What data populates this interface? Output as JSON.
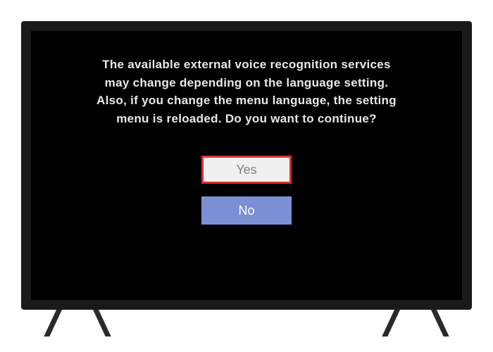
{
  "dialog": {
    "message": "The available external voice recognition services may change depending on the language setting. Also, if you change the menu language, the setting menu is reloaded. Do you want to continue?",
    "yes_label": "Yes",
    "no_label": "No"
  },
  "colors": {
    "highlight_border": "#d93030",
    "secondary_button": "#7a8fd4"
  }
}
